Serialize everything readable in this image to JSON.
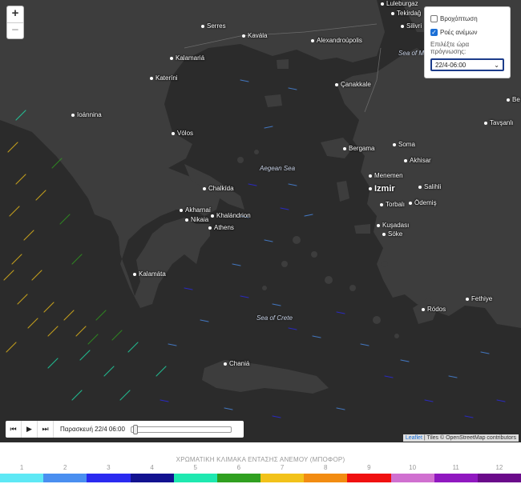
{
  "map": {
    "cities": [
      {
        "name": "Serres"
      },
      {
        "name": "Kavála"
      },
      {
        "name": "Alexandroúpolis"
      },
      {
        "name": "Kalamariá"
      },
      {
        "name": "Kateríni"
      },
      {
        "name": "Ioánnina"
      },
      {
        "name": "Vólos"
      },
      {
        "name": "Chalkída"
      },
      {
        "name": "Akharnaí"
      },
      {
        "name": "Khalándrion"
      },
      {
        "name": "Nikaia"
      },
      {
        "name": "Athens"
      },
      {
        "name": "Kalamáta"
      },
      {
        "name": "Chaniá"
      },
      {
        "name": "Çanakkale"
      },
      {
        "name": "Bergama"
      },
      {
        "name": "Soma"
      },
      {
        "name": "Akhisar"
      },
      {
        "name": "Menemen"
      },
      {
        "name": "Izmir"
      },
      {
        "name": "Salihli"
      },
      {
        "name": "Torbalı"
      },
      {
        "name": "Ödemiş"
      },
      {
        "name": "Kuşadası"
      },
      {
        "name": "Söke"
      },
      {
        "name": "Ródos"
      },
      {
        "name": "Fethiye"
      },
      {
        "name": "Tavşanlı"
      },
      {
        "name": "Luleburgaz"
      },
      {
        "name": "Silivri"
      },
      {
        "name": "Tekirdağ"
      },
      {
        "name": "Be"
      }
    ],
    "seas": [
      {
        "name": "Aegean Sea"
      },
      {
        "name": "Sea of Crete"
      },
      {
        "name": "Sea of Marmara"
      }
    ]
  },
  "zoom": {
    "in_label": "+",
    "out_label": "−"
  },
  "panel": {
    "rain_label": "Βροχόπτωση",
    "rain_checked": false,
    "wind_label": "Ροές ανέμων",
    "wind_checked": true,
    "select_prompt": "Επιλέξτε ώρα πρόγνωσης:",
    "selected_time": "22/4-06:00"
  },
  "player": {
    "back_icon": "skip-back-icon",
    "play_icon": "play-icon",
    "forward_icon": "skip-forward-icon",
    "time_text": "Παρασκευή 22/4 06:00",
    "slider_fraction": 0.0
  },
  "attribution": {
    "leaflet": "Leaflet",
    "tiles": "| Tiles © OpenStreetMap contributors"
  },
  "legend": {
    "title": "ΧΡΩΜΑΤΙΚΗ ΚΛΙΜΑΚΑ ΕΝΤΑΣΗΣ ΑΝΕΜΟΥ (ΜΠΟΦΟΡ)",
    "levels": [
      {
        "label": "1",
        "color": "#5ee8f5"
      },
      {
        "label": "2",
        "color": "#4a8ff0"
      },
      {
        "label": "3",
        "color": "#2a2af0"
      },
      {
        "label": "4",
        "color": "#121290"
      },
      {
        "label": "5",
        "color": "#1ee8b0"
      },
      {
        "label": "6",
        "color": "#30a020"
      },
      {
        "label": "7",
        "color": "#f2c21a"
      },
      {
        "label": "8",
        "color": "#f28c12"
      },
      {
        "label": "9",
        "color": "#f01010"
      },
      {
        "label": "10",
        "color": "#d070d0"
      },
      {
        "label": "11",
        "color": "#9018c0"
      },
      {
        "label": "12",
        "color": "#6a0a8a"
      }
    ]
  }
}
